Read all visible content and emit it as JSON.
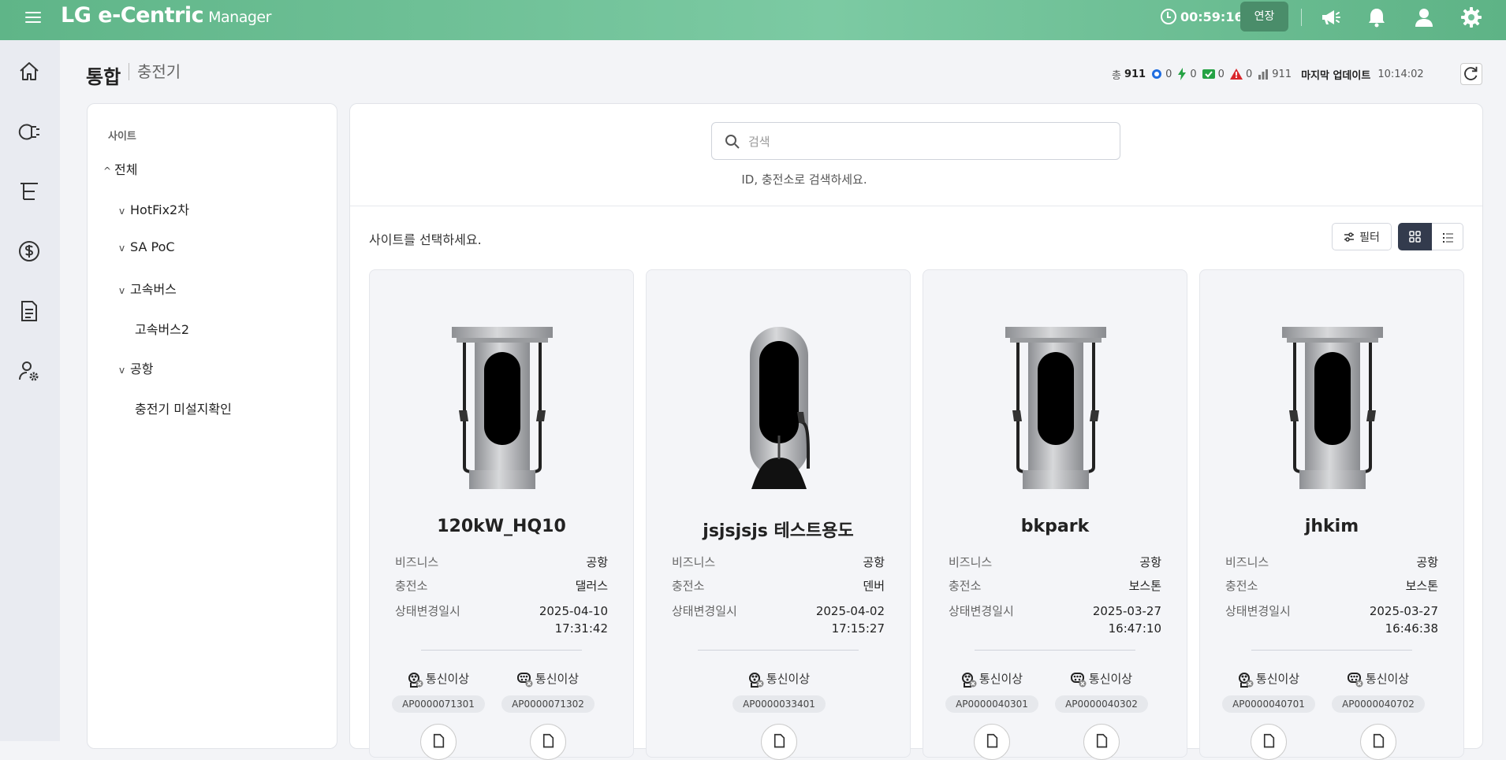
{
  "header": {
    "logo_main": "LG e-Centric",
    "logo_sub": "Manager",
    "timer": "00:59:16",
    "extend_label": "연장"
  },
  "page": {
    "title": "통합",
    "subtitle": "충전기"
  },
  "stats": {
    "total_label": "총",
    "total": "911",
    "blue": "0",
    "green_bolt": "0",
    "green_check": "0",
    "warning": "0",
    "bars": "911",
    "last_update_label": "마지막 업데이트",
    "last_update_time": "10:14:02"
  },
  "tree": {
    "header": "사이트",
    "items": [
      "전체",
      "HotFix2차",
      "SA PoC",
      "고속버스",
      "고속버스2",
      "공항",
      "충전기 미설지확인"
    ]
  },
  "search": {
    "placeholder": "검색",
    "hint": "ID, 충전소로 검색하세요."
  },
  "content": {
    "select_msg": "사이트를 선택하세요.",
    "filter_label": "필터"
  },
  "labels": {
    "business": "비즈니스",
    "station": "충전소",
    "changed": "상태변경일시"
  },
  "cards": [
    {
      "name": "120kW_HQ10",
      "business": "공항",
      "station": "댈러스",
      "date": "2025-04-10",
      "time": "17:31:42",
      "connectors": [
        {
          "status": "통신이상",
          "id": "AP0000071301"
        },
        {
          "status": "통신이상",
          "id": "AP0000071302"
        }
      ]
    },
    {
      "name": "jsjsjsjs 테스트용도",
      "business": "공항",
      "station": "덴버",
      "date": "2025-04-02",
      "time": "17:15:27",
      "connectors": [
        {
          "status": "통신이상",
          "id": "AP0000033401"
        }
      ]
    },
    {
      "name": "bkpark",
      "business": "공항",
      "station": "보스톤",
      "date": "2025-03-27",
      "time": "16:47:10",
      "connectors": [
        {
          "status": "통신이상",
          "id": "AP0000040301"
        },
        {
          "status": "통신이상",
          "id": "AP0000040302"
        }
      ]
    },
    {
      "name": "jhkim",
      "business": "공항",
      "station": "보스톤",
      "date": "2025-03-27",
      "time": "16:46:38",
      "connectors": [
        {
          "status": "통신이상",
          "id": "AP0000040701"
        },
        {
          "status": "통신이상",
          "id": "AP0000040702"
        }
      ]
    }
  ]
}
